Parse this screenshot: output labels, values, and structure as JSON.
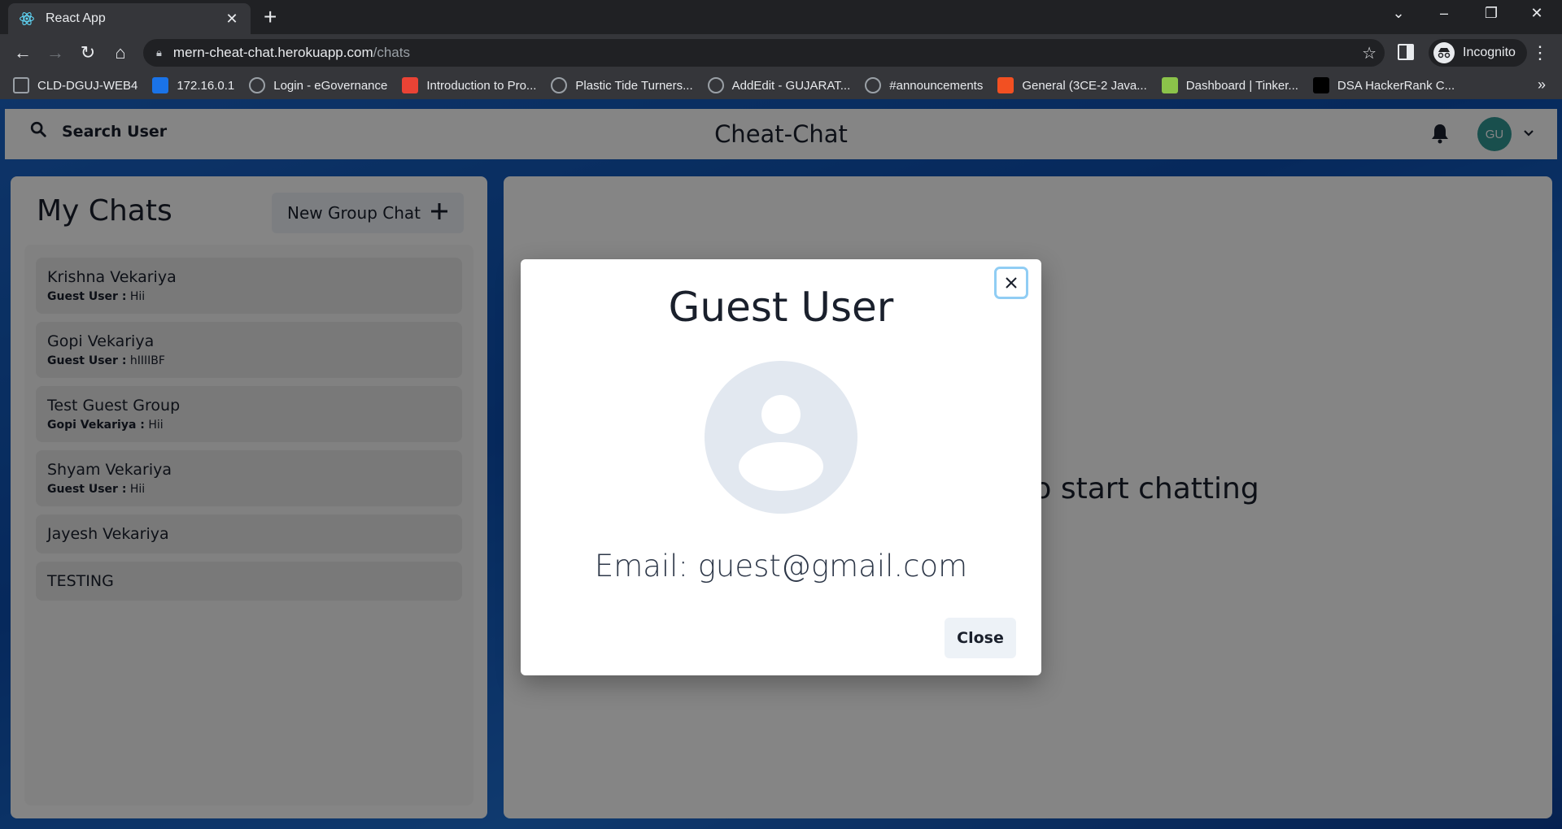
{
  "browser": {
    "tab_title": "React App",
    "url_host": "mern-cheat-chat.herokuapp.com",
    "url_path": "/chats",
    "incognito_label": "Incognito",
    "bookmarks": [
      {
        "label": "CLD-DGUJ-WEB4",
        "icon": "site-icon",
        "color": "#9aa0a6"
      },
      {
        "label": "172.16.0.1",
        "icon": "s-logo-icon",
        "color": "#1a73e8"
      },
      {
        "label": "Login - eGovernance",
        "icon": "globe-icon",
        "color": "#9aa0a6"
      },
      {
        "label": "Introduction to Pro...",
        "icon": "google-icon",
        "color": "#ea4335"
      },
      {
        "label": "Plastic Tide Turners...",
        "icon": "globe-icon",
        "color": "#9aa0a6"
      },
      {
        "label": "AddEdit - GUJARAT...",
        "icon": "globe-icon",
        "color": "#9aa0a6"
      },
      {
        "label": "#announcements",
        "icon": "globe-icon",
        "color": "#9aa0a6"
      },
      {
        "label": "General (3CE-2 Java...",
        "icon": "microsoft-icon",
        "color": "#f25022"
      },
      {
        "label": "Dashboard | Tinker...",
        "icon": "tinkercad-icon",
        "color": "#8bc34a"
      },
      {
        "label": "DSA HackerRank C...",
        "icon": "hackerrank-icon",
        "color": "#000000"
      }
    ]
  },
  "header": {
    "search_label": "Search User",
    "app_title": "Cheat-Chat",
    "avatar_initials": "GU",
    "avatar_color": "#319795"
  },
  "chats": {
    "title": "My Chats",
    "new_group_label": "New Group Chat",
    "items": [
      {
        "name": "Krishna Vekariya",
        "sender": "Guest User :",
        "message": "Hii"
      },
      {
        "name": "Gopi Vekariya",
        "sender": "Guest User :",
        "message": "hIIIIBF"
      },
      {
        "name": "Test Guest Group",
        "sender": "Gopi Vekariya :",
        "message": "Hii"
      },
      {
        "name": "Shyam Vekariya",
        "sender": "Guest User :",
        "message": "Hii"
      },
      {
        "name": "Jayesh Vekariya"
      },
      {
        "name": "TESTING"
      }
    ]
  },
  "chatbox": {
    "empty_text": "Click on a user to start chatting"
  },
  "modal": {
    "title": "Guest User",
    "email_text": "Email: guest@gmail.com",
    "close_label": "Close"
  }
}
